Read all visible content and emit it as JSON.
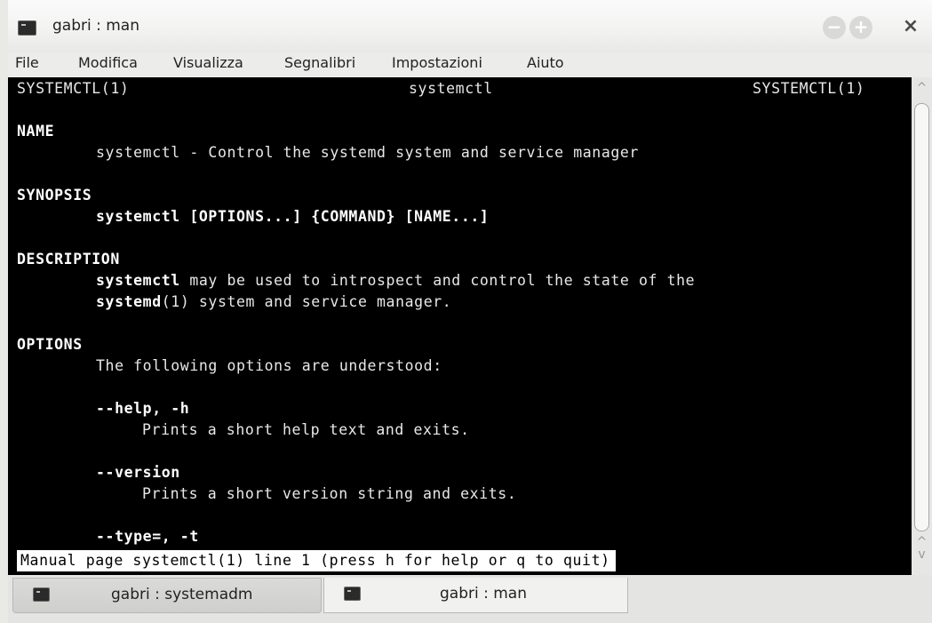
{
  "window": {
    "title": "gabri : man",
    "min_glyph": "−",
    "max_glyph": "+",
    "close_glyph": "×"
  },
  "menu": [
    "File",
    "Modifica",
    "Visualizza",
    "Segnalibri",
    "Impostazioni",
    "Aiuto"
  ],
  "man": {
    "header_left": "SYSTEMCTL(1)",
    "header_center": "systemctl",
    "header_right": "SYSTEMCTL(1)",
    "name_heading": "NAME",
    "name_text": "systemctl - Control the systemd system and service manager",
    "synopsis_heading": "SYNOPSIS",
    "synopsis_text": "systemctl [OPTIONS...] {COMMAND} [NAME...]",
    "description_heading": "DESCRIPTION",
    "description_line1_bold": "systemctl",
    "description_line1_rest": " may be used to introspect and control the state of the",
    "description_line2_bold": "systemd",
    "description_line2_rest": "(1) system and service manager.",
    "options_heading": "OPTIONS",
    "options_intro": "The following options are understood:",
    "opt1_name": "--help, -h",
    "opt1_desc": "Prints a short help text and exits.",
    "opt2_name": "--version",
    "opt2_desc": "Prints a short version string and exits.",
    "opt3_name": "--type=, -t",
    "status": "Manual page systemctl(1) line 1 (press h for help or q to quit)"
  },
  "tabs": [
    {
      "label": "gabri : systemadm",
      "active": false
    },
    {
      "label": "gabri : man",
      "active": true
    }
  ],
  "scrollbar": {
    "up_glyph": "^",
    "down_glyph": "^\nv"
  }
}
